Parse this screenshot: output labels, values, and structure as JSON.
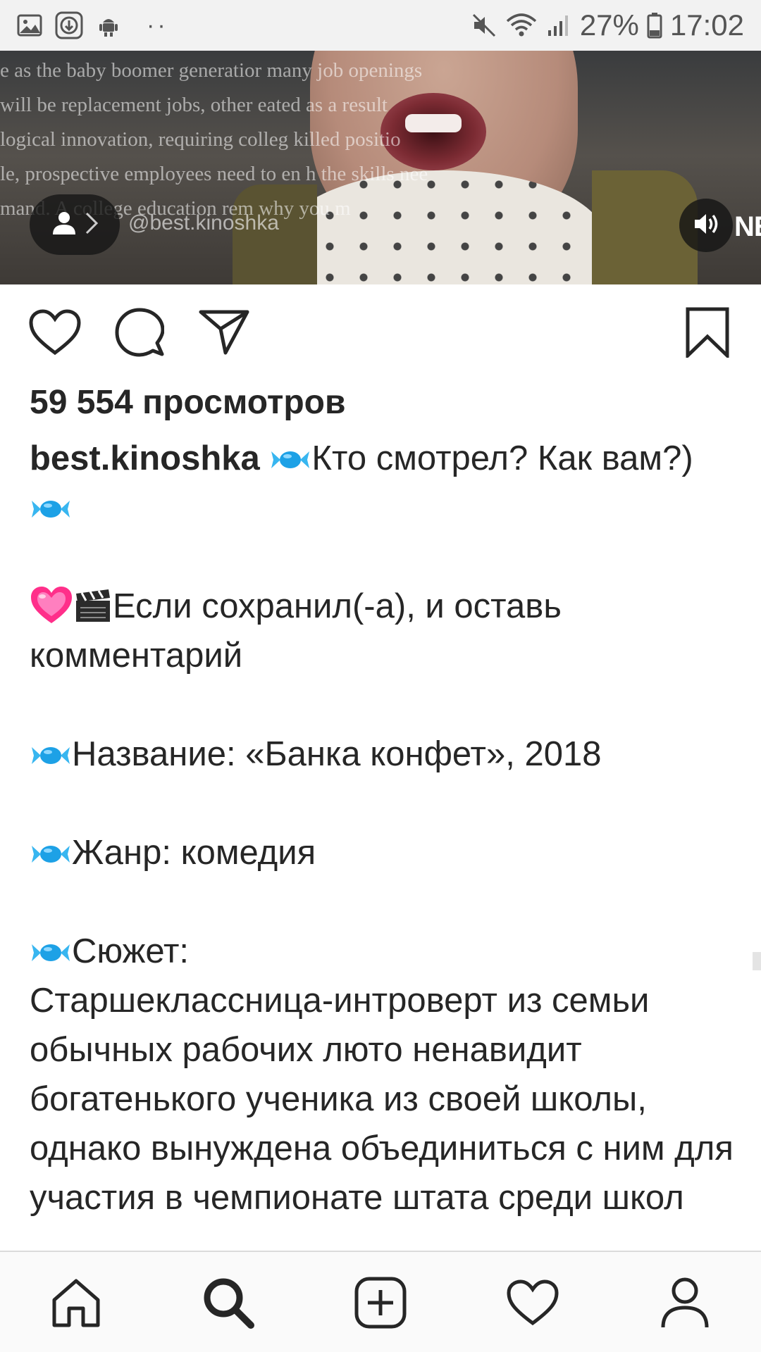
{
  "status_bar": {
    "battery": "27%",
    "time": "17:02",
    "icons": [
      "gallery-icon",
      "download-icon",
      "android-icon",
      "more-dots-icon",
      "mute-icon",
      "wifi-icon",
      "signal-icon",
      "battery-icon"
    ],
    "dots": "··"
  },
  "video": {
    "watermark": "@best.kinoshka",
    "background_lines": [
      "e as the baby boomer generatior                                   many job openings",
      "will be replacement jobs, other                                  eated as a result",
      "logical innovation, requiring colleg                              killed positio",
      "le, prospective employees need to en                           h the skills nee",
      "mand. A college education rem                                  why you m"
    ],
    "corner_text": "NE",
    "icons": [
      "user-tag-icon",
      "sound-icon"
    ]
  },
  "actions": {
    "icons": [
      "like-icon",
      "comment-icon",
      "share-icon",
      "bookmark-icon"
    ]
  },
  "post": {
    "views": "59 554 просмотров",
    "username": "best.kinoshka",
    "line1": "Кто смотрел? Как вам?)",
    "line2": "Если сохранил(-а), и оставь комментарий",
    "line3": "Название: «Банка конфет», 2018",
    "line4": "Жанр: комедия",
    "line5": "Сюжет:",
    "plot": "Старшеклассница-интроверт из семьи обычных рабочих люто ненавидит богатенького ученика из своей школы, однако вынуждена объединиться с ним для участия в чемпионате штата среди школ"
  },
  "bottom_nav": {
    "items": [
      "home-icon",
      "search-icon",
      "add-post-icon",
      "activity-heart-icon",
      "profile-icon"
    ]
  },
  "colors": {
    "text": "#262626",
    "status_bar_bg": "#f2f2f2",
    "nav_bg": "#fafafa",
    "candy": "#1da1e6"
  }
}
